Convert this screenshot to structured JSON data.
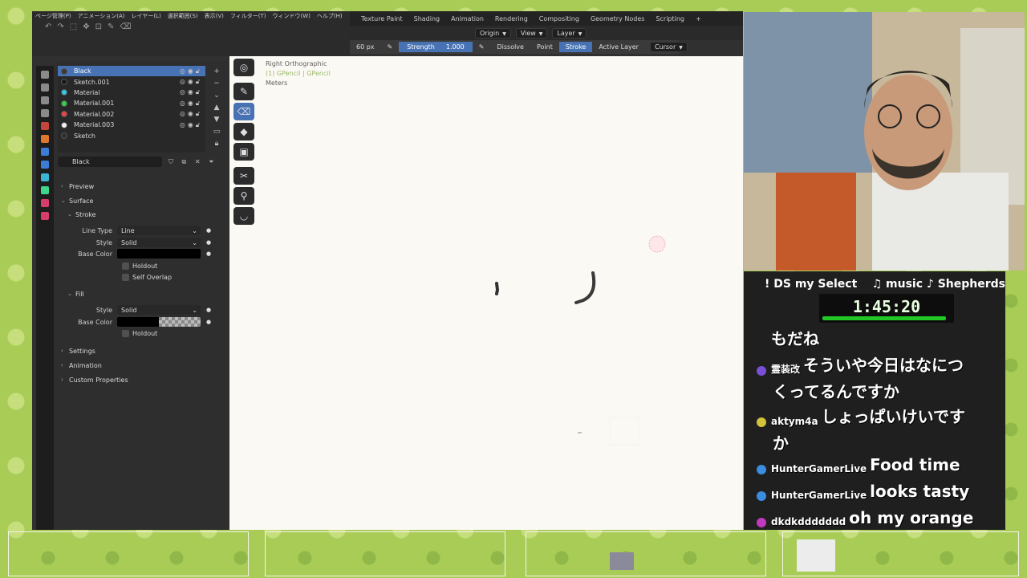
{
  "blender": {
    "menu": [
      "ページ管理(P)",
      "アニメーション(A)",
      "レイヤー(L)",
      "選択範囲(S)",
      "表示(V)",
      "フィルター(T)",
      "ウィンドウ(W)",
      "ヘルプ(H)"
    ],
    "workspace_tabs": [
      "Texture Paint",
      "Shading",
      "Animation",
      "Rendering",
      "Compositing",
      "Geometry Nodes",
      "Scripting",
      "+"
    ],
    "header": {
      "origin": "Origin",
      "view": "View",
      "layer": "Layer"
    },
    "tool_settings": {
      "radius": "60 px",
      "strength_label": "Strength",
      "strength_value": "1.000",
      "mode_dissolve": "Dissolve",
      "mode_point": "Point",
      "mode_stroke": "Stroke",
      "active_layer": "Active Layer",
      "cursor": "Cursor"
    },
    "materials": [
      {
        "name": "Black",
        "color": "#3a3a3a",
        "active": true
      },
      {
        "name": "Sketch.001",
        "color": "#1a1a1a"
      },
      {
        "name": "Material",
        "color": "#35c7e6"
      },
      {
        "name": "Material.001",
        "color": "#35d04a"
      },
      {
        "name": "Material.002",
        "color": "#e84545"
      },
      {
        "name": "Material.003",
        "color": "#f2f2f2"
      },
      {
        "name": "Sketch",
        "color": "#2e2e2e"
      }
    ],
    "slot_name": "Black",
    "panels": {
      "preview": "Preview",
      "surface": "Surface",
      "stroke": "Stroke",
      "line_type_label": "Line Type",
      "line_type_value": "Line",
      "style_label": "Style",
      "style_value": "Solid",
      "base_color_label": "Base Color",
      "holdout": "Holdout",
      "self_overlap": "Self Overlap",
      "fill": "Fill",
      "fill_style_label": "Style",
      "fill_style_value": "Solid",
      "fill_base_color_label": "Base Color",
      "fill_holdout": "Holdout",
      "settings": "Settings",
      "animation": "Animation",
      "custom_properties": "Custom Properties"
    },
    "viewport": {
      "view_name": "Right Orthographic",
      "object": "(1) GPencil | GPencil",
      "units": "Meters"
    }
  },
  "stream": {
    "status_left": "! DS my Select",
    "status_right": "♫ music ♪ Shepherds",
    "timer": "1:45:20",
    "timer_progress": 0.96,
    "chat": [
      {
        "name": "",
        "message": "もだね",
        "badge_color": ""
      },
      {
        "name": "霊装改",
        "message": "そういや今日はなにつ",
        "cont": "くってるんですか",
        "badge_color": "#7a4fd8"
      },
      {
        "name": "aktym4a",
        "message": "しょっぱいけいです",
        "cont": "か",
        "badge_color": "#d2c33a"
      },
      {
        "name": "HunterGamerLive",
        "message": "Food time",
        "badge_color": "#3a8de0"
      },
      {
        "name": "HunterGamerLive",
        "message": "looks tasty",
        "badge_color": "#3a8de0"
      },
      {
        "name": "dkdkddddddd",
        "message": "oh my orange",
        "badge_color": "#c03ac0"
      }
    ]
  }
}
